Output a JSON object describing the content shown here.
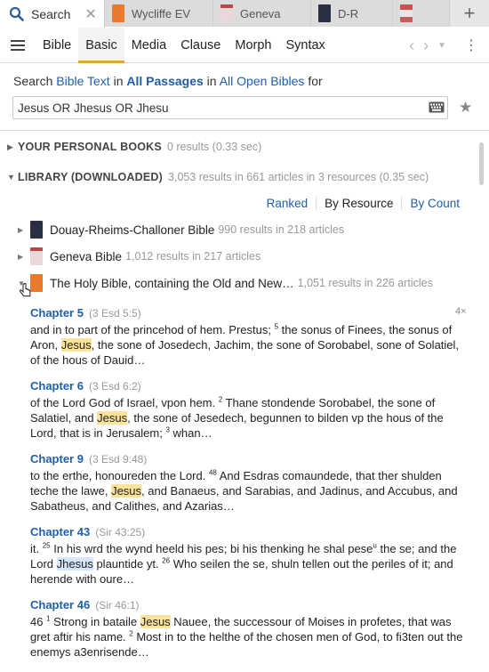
{
  "tabs": [
    {
      "label": "Search",
      "icon": "magnifier-icon",
      "close": "✕"
    },
    {
      "label": "Wycliffe EV",
      "color": "#e87a2c"
    },
    {
      "label": "Geneva",
      "color": "#c9a3a3"
    },
    {
      "label": "D-R",
      "color": "#2b2f44"
    },
    {
      "label": "",
      "color": "#d76b6b"
    }
  ],
  "add_tab": "+",
  "modes": [
    "Bible",
    "Basic",
    "Media",
    "Clause",
    "Morph",
    "Syntax"
  ],
  "active_mode": "Basic",
  "search": {
    "prefix": "Search",
    "scope_kind": "Bible Text",
    "in1": "in",
    "scope_range": "All Passages",
    "in2": "in",
    "scope_books": "All Open Bibles",
    "suffix": "for",
    "query": "Jesus OR Jhesus OR Jhesu"
  },
  "sections": {
    "personal": {
      "title": "YOUR PERSONAL BOOKS",
      "meta": "0 results (0.33 sec)"
    },
    "library": {
      "title": "LIBRARY (DOWNLOADED)",
      "meta": "3,053 results in 661 articles in 3 resources (0.35 sec)"
    }
  },
  "sort": {
    "ranked": "Ranked",
    "by_resource": "By Resource",
    "by_count": "By Count"
  },
  "resources": [
    {
      "name": "Douay-Rheims-Challoner Bible",
      "meta": "990 results in 218 articles",
      "color": "#2b2f44"
    },
    {
      "name": "Geneva Bible",
      "meta": "1,012 results in 217 articles",
      "color": "#c9a3a3"
    },
    {
      "name": "The Holy Bible, containing the Old and New…",
      "meta": "1,051 results in 226 articles",
      "color": "#e87a2c"
    }
  ],
  "count_badge": "4×",
  "hits": [
    {
      "chapter": "Chapter 5",
      "ref": "(3 Esd 5:5)",
      "t1": "and in to part of the princehod of hem. Prestus; ",
      "v1": "5",
      "t2": " the sonus of Finees, the sonus of Aron, ",
      "term": "Jesus",
      "t3": ", the sone of Josedech, Jachim, the sone of Sorobabel, sone of Solatiel, of the hous of Dauid…"
    },
    {
      "chapter": "Chapter 6",
      "ref": "(3 Esd 6:2)",
      "t1": "of the Lord God of Israel, vpon hem. ",
      "v1": "2",
      "t2": " Thane stondende Sorobabel, the sone of Salatiel, and ",
      "term": "Jesus",
      "t3": ", the sone of Jesedech, begunnen to bilden vp the hous of the Lord, that is in Jerusalem; ",
      "v2": "3",
      "t4": " whan…"
    },
    {
      "chapter": "Chapter 9",
      "ref": "(3 Esd 9:48)",
      "t1": "to the erthe, honoureden the Lord. ",
      "v1": "48",
      "t2": " And Esdras comaundede, that ther shulden teche the lawe, ",
      "term": "Jesus",
      "t3": ", and Banaeus, and Sarabias, and Jadinus, and Accubus, and Sabatheus, and Calithes, and Azarias…"
    },
    {
      "chapter": "Chapter 43",
      "ref": "(Sir 43:25)",
      "t1": "it. ",
      "v1": "25",
      "t2": " In his wrd the wynd heeld his pes; bi his thenking he shal pese",
      "v1b": "u",
      "t2b": " the se; and the Lord ",
      "term": "Jhesus",
      "t3": " plauntide yt. ",
      "v2": "26",
      "t4": " Who seilen the se, shuln tellen out the periles of it; and herende with oure…"
    },
    {
      "chapter": "Chapter 46",
      "ref": "(Sir 46:1)",
      "t1": "46 ",
      "v1": "1",
      "t2": " Strong in bataile ",
      "term": "Jesus",
      "t3": " Nauee, the successour of Moises in profetes, that was gret aftir his name. ",
      "v2": "2",
      "t4": " Most in to the helthe of the chosen men of God, to fi3ten out the enemys a3enrisende…"
    }
  ]
}
